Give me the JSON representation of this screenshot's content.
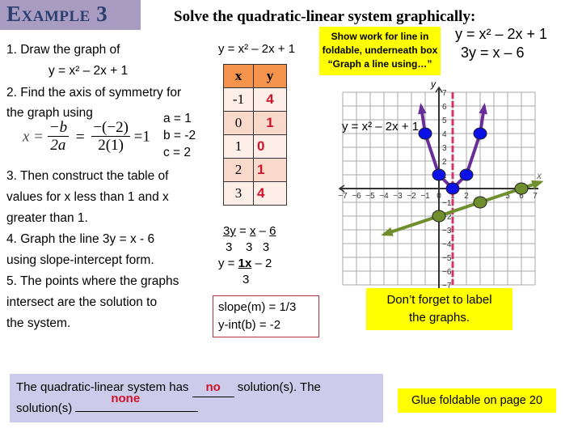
{
  "title": "Example 3",
  "heading": "Solve the quadratic-linear system graphically:",
  "system": {
    "eq1": "y = x² – 2x + 1",
    "eq2": "3y = x – 6"
  },
  "note_top": [
    "Show work for line in",
    "foldable, underneath box",
    "“Graph a line using…”"
  ],
  "steps": {
    "s1a": "1. Draw the graph of",
    "s1b": "y = x² – 2x + 1",
    "s2a": "2. Find the axis of symmetry for",
    "s2b": "the graph using",
    "coef_a": "a = 1",
    "coef_b": "b = -2",
    "coef_c": "c = 2",
    "formula": {
      "lhs": "x =",
      "num1": "−b",
      "den1": "2a",
      "eq2": "=",
      "num2": "−(−2)",
      "den2": "2(1)",
      "result": "=1"
    },
    "s3": [
      "3. Then construct the table of",
      "values for x less than 1 and x",
      "greater than 1."
    ],
    "s4": [
      "4.  Graph the line 3y = x - 6",
      "using slope-intercept form."
    ],
    "s5": [
      "5. The points where the graphs",
      "intersect are the solution to",
      "the system."
    ]
  },
  "table": {
    "caption": "y = x² – 2x + 1",
    "headers": [
      "x",
      "y"
    ],
    "rows": [
      [
        "-1",
        "4"
      ],
      [
        "0",
        "1"
      ],
      [
        "1",
        "0"
      ],
      [
        "2",
        "1"
      ],
      [
        "3",
        "4"
      ]
    ]
  },
  "line_work": {
    "r1": {
      "a": "3y",
      "b": " = ",
      "c": "x",
      "d": " – ",
      "e": "6"
    },
    "r2": [
      "3",
      "3",
      "3"
    ],
    "r3": {
      "a": "y = ",
      "b": "1x",
      "c": " – 2"
    },
    "r4": "3"
  },
  "slope_box": {
    "slope": "slope(m) = 1/3",
    "yint": "y-int(b) = -2"
  },
  "graph_label": "y = x² – 2x + 1",
  "note_label": [
    "Don’t forget to label",
    "the graphs."
  ],
  "answer": {
    "part1": "The quadratic-linear system has ",
    "blank1": "no",
    "part2": " solution(s).  The",
    "part3": "solution(s) ",
    "blank2": "none"
  },
  "note_glue": "Glue foldable on page 20",
  "chart_data": {
    "type": "line",
    "title": "",
    "xlabel": "x",
    "ylabel": "y",
    "xlim": [
      -7,
      7
    ],
    "ylim": [
      -7,
      7
    ],
    "grid": true,
    "x_ticks": [
      -7,
      -6,
      -5,
      -4,
      -3,
      -2,
      -1,
      0,
      1,
      2,
      5,
      6,
      7
    ],
    "y_ticks": [
      7,
      6,
      5,
      4,
      3,
      2,
      1,
      -1,
      -2,
      -3,
      -4,
      -5,
      -6,
      -7
    ],
    "axis_of_symmetry": {
      "x": 1,
      "color": "#d6336c",
      "style": "dashed"
    },
    "series": [
      {
        "name": "y = x² – 2x + 1",
        "kind": "parabola",
        "color": "#6a2e9a",
        "point_color": "#0a10e6",
        "points": [
          [
            -1,
            4
          ],
          [
            0,
            1
          ],
          [
            1,
            0
          ],
          [
            2,
            1
          ],
          [
            3,
            4
          ]
        ],
        "extend_to": [
          [
            -1.3,
            6
          ],
          [
            3.3,
            6
          ]
        ]
      },
      {
        "name": "3y = x – 6",
        "kind": "line",
        "color": "#6f8f2e",
        "point_color": "#6f8f2e",
        "points": [
          [
            0,
            -2
          ],
          [
            3,
            -1
          ],
          [
            6,
            0
          ]
        ],
        "extend_to": [
          [
            -4,
            -3.33
          ],
          [
            7.4,
            0.47
          ]
        ]
      }
    ]
  }
}
